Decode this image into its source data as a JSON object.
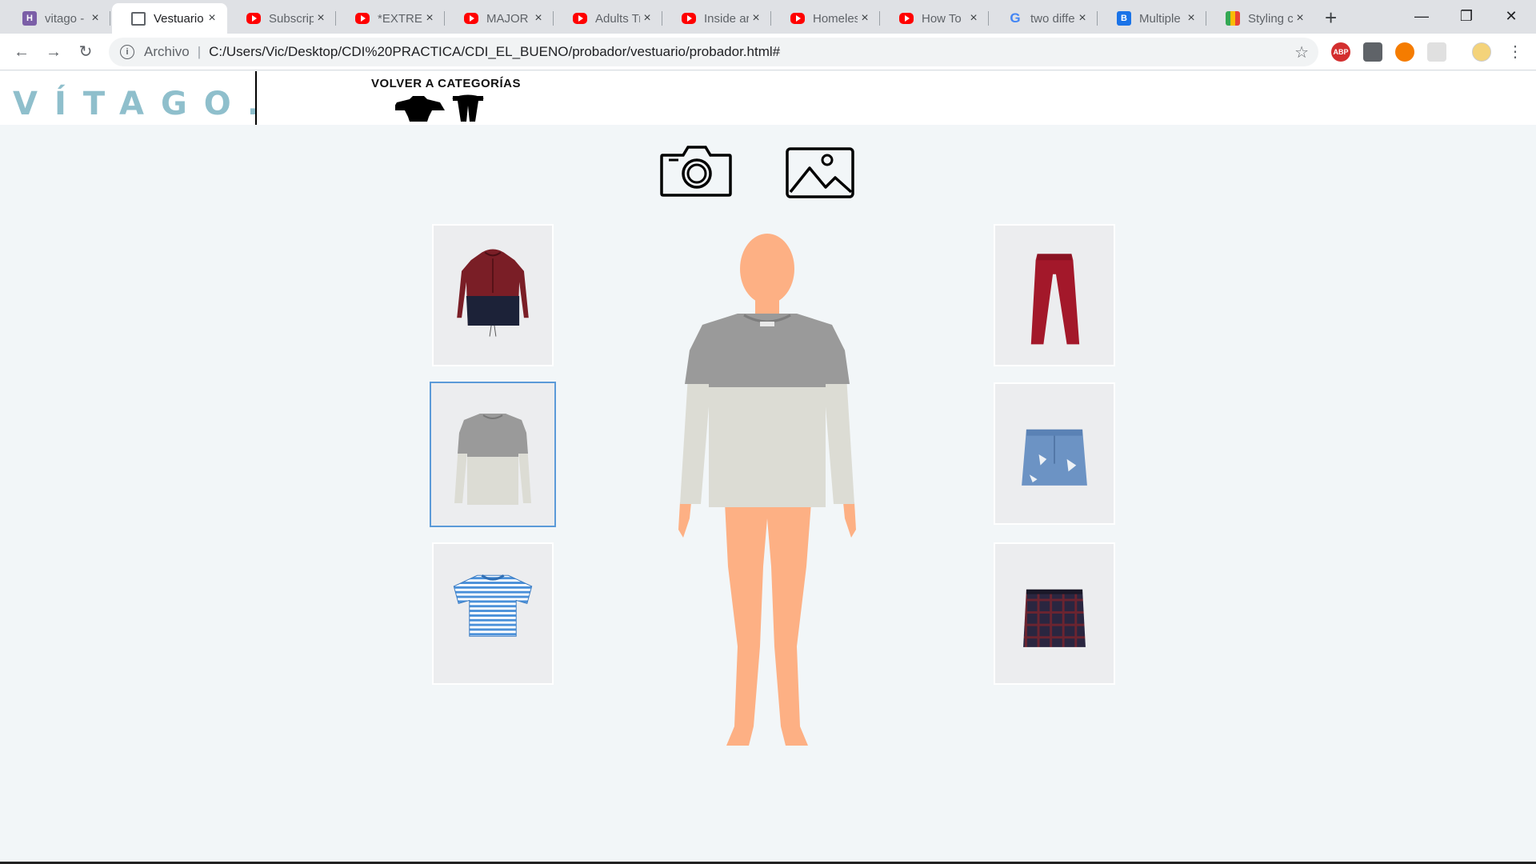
{
  "browser": {
    "tabs": [
      {
        "title": "vitago -",
        "icon": "h-icon"
      },
      {
        "title": "Vestuario",
        "icon": "document-icon"
      },
      {
        "title": "Subscrip",
        "icon": "youtube-icon"
      },
      {
        "title": "*EXTREM",
        "icon": "youtube-icon"
      },
      {
        "title": "MAJOR",
        "icon": "youtube-icon"
      },
      {
        "title": "Adults Tr",
        "icon": "youtube-icon"
      },
      {
        "title": "Inside ar",
        "icon": "youtube-icon"
      },
      {
        "title": "Homeles",
        "icon": "youtube-icon"
      },
      {
        "title": "How To",
        "icon": "youtube-icon"
      },
      {
        "title": "two diffe",
        "icon": "google-icon"
      },
      {
        "title": "Multiple",
        "icon": "b-icon"
      },
      {
        "title": "Styling c",
        "icon": "grid-icon"
      }
    ],
    "close_glyph": "×",
    "new_tab_glyph": "+",
    "address_label": "Archivo",
    "address_separator": "|",
    "url": "C:/Users/Vic/Desktop/CDI%20PRACTICA/CDI_EL_BUENO/probador/vestuario/probador.html#",
    "extensions": [
      {
        "label": "ABP",
        "color": "#d32f2f"
      },
      {
        "label": "",
        "color": "#5f6368"
      },
      {
        "label": "",
        "color": "#f57c00"
      },
      {
        "label": "",
        "color": "#e0e0e0"
      }
    ]
  },
  "header": {
    "logo": "VÍTAGO.",
    "back_link": "VOLVER A CATEGORÍAS",
    "category_icons": [
      "shirt-icon",
      "pants-icon"
    ]
  },
  "actions": [
    "camera-icon",
    "image-icon"
  ],
  "left_items": [
    {
      "name": "windbreaker-jacket",
      "colors": [
        "#7a1e26",
        "#1c2238"
      ]
    },
    {
      "name": "colorblock-sweater",
      "colors": [
        "#9a9a9a",
        "#dcdcd4"
      ]
    },
    {
      "name": "striped-tshirt",
      "colors": [
        "#4a90d9",
        "#ffffff"
      ]
    }
  ],
  "right_items": [
    {
      "name": "red-pants",
      "colors": [
        "#a3182a"
      ]
    },
    {
      "name": "denim-skirt",
      "colors": [
        "#6c93c4"
      ]
    },
    {
      "name": "plaid-skirt",
      "colors": [
        "#2a2640",
        "#6b2430"
      ]
    }
  ],
  "selected_item": "colorblock-sweater",
  "colors": {
    "accent_logo": "#8fbfcc",
    "selection_border": "#5b9ad8",
    "skin": "#fdb084"
  }
}
